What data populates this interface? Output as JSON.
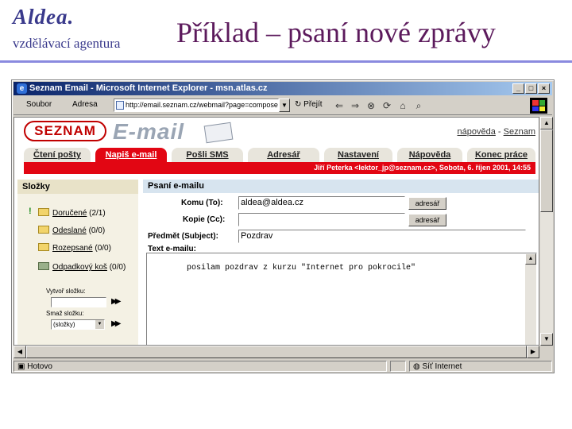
{
  "slide": {
    "brand": "Aldea.",
    "brand_subtitle": "vzdělávací agentura",
    "title": "Příklad – psaní nové zprávy"
  },
  "browser": {
    "window_title": "Seznam Email - Microsoft Internet Explorer - msn.atlas.cz",
    "controls": [
      "_",
      "□",
      "×"
    ],
    "menu_file": "Soubor",
    "address_label": "Adresa",
    "address_value": "http://email.seznam.cz/webmail?page=compose",
    "go_label": "Přejít",
    "toolbar_icons": [
      "back-icon",
      "forward-icon",
      "stop-icon",
      "refresh-icon",
      "home-icon",
      "search-icon"
    ],
    "status_text": "Hotovo",
    "zone_text": "Síť Internet"
  },
  "seznam": {
    "logo": "SEZNAM",
    "email_logo": "E-mail",
    "help_link": "nápověda",
    "seznam_link": "Seznam",
    "tabs": [
      {
        "label": "Čtení pošty",
        "active": false
      },
      {
        "label": "Napiš e-mail",
        "active": true
      },
      {
        "label": "Pošli SMS",
        "active": false
      },
      {
        "label": "Adresář",
        "active": false
      },
      {
        "label": "Nastavení",
        "active": false
      },
      {
        "label": "Nápověda",
        "active": false
      },
      {
        "label": "Konec práce",
        "active": false
      }
    ],
    "user_info": "Jiří Peterka <lektor_jp@seznam.cz>, Sobota, 6. říjen 2001, 14:55",
    "colors": {
      "accent_red": "#e20613"
    }
  },
  "sidebar": {
    "heading": "Složky",
    "folders": [
      {
        "name": "Doručené",
        "count": "(2/1)"
      },
      {
        "name": "Odeslané",
        "count": "(0/0)"
      },
      {
        "name": "Rozepsané",
        "count": "(0/0)"
      },
      {
        "name": "Odpadkový koš",
        "count": "(0/0)"
      }
    ],
    "create_label": "Vytvoř složku:",
    "delete_label": "Smaž složku:",
    "delete_select": "(složky)"
  },
  "compose": {
    "heading": "Psaní e-mailu",
    "to_label": "Komu (To):",
    "to_value": "aldea@aldea.cz",
    "cc_label": "Kopie (Cc):",
    "cc_value": "",
    "subject_label": "Předmět (Subject):",
    "subject_value": "Pozdrav",
    "addressbook_button": "adresář",
    "body_label": "Text e-mailu:",
    "body_value": "posilam pozdrav z kurzu \"Internet pro pokrocile\""
  }
}
